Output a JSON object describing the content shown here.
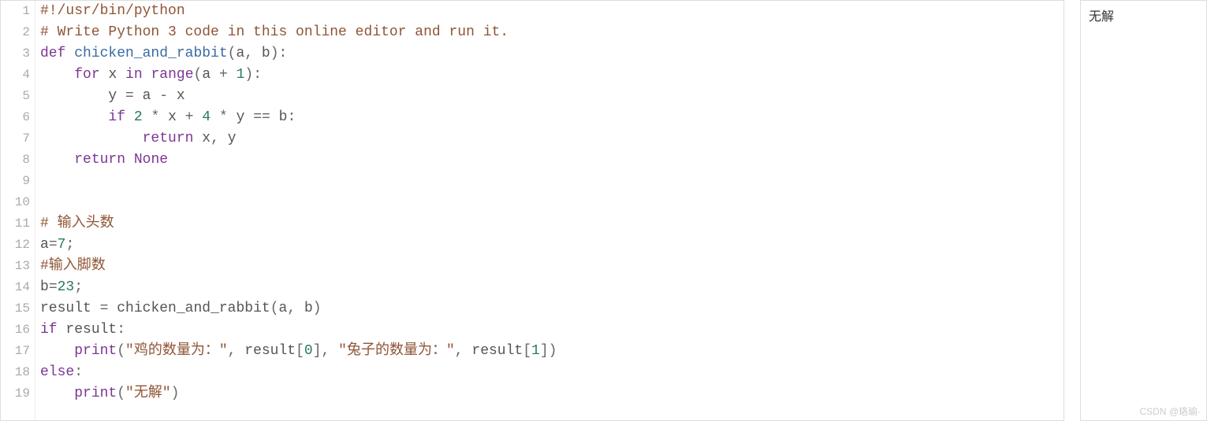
{
  "editor": {
    "line_numbers": [
      "1",
      "2",
      "3",
      "4",
      "5",
      "6",
      "7",
      "8",
      "9",
      "10",
      "11",
      "12",
      "13",
      "14",
      "15",
      "16",
      "17",
      "18",
      "19"
    ],
    "lines": {
      "l1": {
        "shebang": "#!/usr/bin/python"
      },
      "l2": {
        "comment": "# Write Python 3 code in this online editor and run it."
      },
      "l3": {
        "kw_def": "def",
        "sp1": " ",
        "fname": "chicken_and_rabbit",
        "lp": "(",
        "a": "a",
        "comma": ",",
        "sp2": " ",
        "b": "b",
        "rp": ")",
        "colon": ":"
      },
      "l4": {
        "indent": "    ",
        "kw_for": "for",
        "sp1": " ",
        "x": "x",
        "sp2": " ",
        "kw_in": "in",
        "sp3": " ",
        "range": "range",
        "lp": "(",
        "a": "a",
        "sp4": " ",
        "plus": "+",
        "sp5": " ",
        "one": "1",
        "rp": ")",
        "colon": ":"
      },
      "l5": {
        "indent": "        ",
        "y": "y",
        "sp1": " ",
        "eq": "=",
        "sp2": " ",
        "a": "a",
        "sp3": " ",
        "minus": "-",
        "sp4": " ",
        "x": "x"
      },
      "l6": {
        "indent": "        ",
        "kw_if": "if",
        "sp1": " ",
        "two": "2",
        "sp2": " ",
        "mul1": "*",
        "sp3": " ",
        "x": "x",
        "sp4": " ",
        "plus": "+",
        "sp5": " ",
        "four": "4",
        "sp6": " ",
        "mul2": "*",
        "sp7": " ",
        "y": "y",
        "sp8": " ",
        "eqeq": "==",
        "sp9": " ",
        "b": "b",
        "colon": ":"
      },
      "l7": {
        "indent": "            ",
        "kw_return": "return",
        "sp1": " ",
        "x": "x",
        "comma": ",",
        "sp2": " ",
        "y": "y"
      },
      "l8": {
        "indent": "    ",
        "kw_return": "return",
        "sp1": " ",
        "none": "None"
      },
      "l11": {
        "comment": "# 输入头数"
      },
      "l12": {
        "a": "a",
        "eq": "=",
        "seven": "7",
        "semi": ";"
      },
      "l13": {
        "comment": "#输入脚数"
      },
      "l14": {
        "b": "b",
        "eq": "=",
        "v": "23",
        "semi": ";"
      },
      "l15": {
        "result": "result",
        "sp1": " ",
        "eq": "=",
        "sp2": " ",
        "fname": "chicken_and_rabbit",
        "lp": "(",
        "a": "a",
        "comma": ",",
        "sp3": " ",
        "b": "b",
        "rp": ")"
      },
      "l16": {
        "kw_if": "if",
        "sp1": " ",
        "result": "result",
        "colon": ":"
      },
      "l17": {
        "indent": "    ",
        "print": "print",
        "lp": "(",
        "s1": "\"鸡的数量为：\"",
        "comma1": ",",
        "sp1": " ",
        "result1": "result",
        "lb1": "[",
        "zero": "0",
        "rb1": "]",
        "comma2": ",",
        "sp2": " ",
        "s2": "\"兔子的数量为：\"",
        "comma3": ",",
        "sp3": " ",
        "result2": "result",
        "lb2": "[",
        "one": "1",
        "rb2": "]",
        "rp": ")"
      },
      "l18": {
        "kw_else": "else",
        "colon": ":"
      },
      "l19": {
        "indent": "    ",
        "print": "print",
        "lp": "(",
        "s": "\"无解\"",
        "rp": ")"
      }
    }
  },
  "output": {
    "text": "无解"
  },
  "watermark": "CSDN @珞瑜·"
}
